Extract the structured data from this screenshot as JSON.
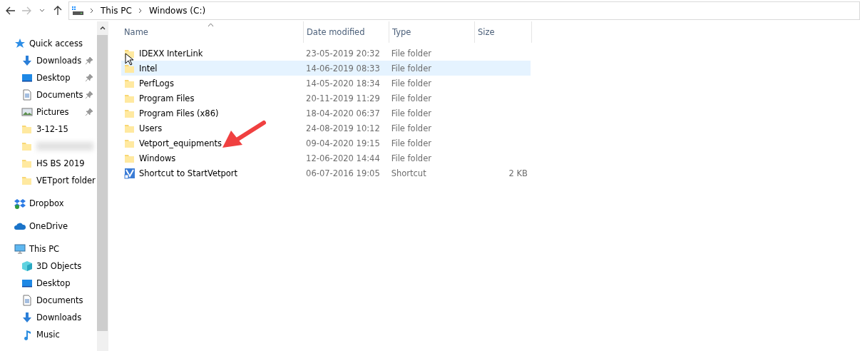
{
  "address_bar": {
    "crumbs": [
      "This PC",
      "Windows (C:)"
    ]
  },
  "nav": [
    {
      "label": "Quick access",
      "kind": "star",
      "children": [
        {
          "label": "Downloads",
          "kind": "download",
          "pinned": true
        },
        {
          "label": "Desktop",
          "kind": "desktop",
          "pinned": true
        },
        {
          "label": "Documents",
          "kind": "document",
          "pinned": true
        },
        {
          "label": "Pictures",
          "kind": "pictures",
          "pinned": true
        },
        {
          "label": "3-12-15",
          "kind": "folder",
          "pinned": false
        },
        {
          "kind": "blurred",
          "pinned": false
        },
        {
          "label": "HS BS 2019",
          "kind": "folder",
          "pinned": false
        },
        {
          "label": "VETport folder",
          "kind": "folder",
          "pinned": false
        }
      ]
    },
    {
      "label": "Dropbox",
      "kind": "dropbox"
    },
    {
      "label": "OneDrive",
      "kind": "cloud"
    },
    {
      "label": "This PC",
      "kind": "pc",
      "children": [
        {
          "label": "3D Objects",
          "kind": "cube",
          "pinned": false
        },
        {
          "label": "Desktop",
          "kind": "desktop",
          "pinned": false
        },
        {
          "label": "Documents",
          "kind": "document",
          "pinned": false
        },
        {
          "label": "Downloads",
          "kind": "download",
          "pinned": false
        },
        {
          "label": "Music",
          "kind": "music",
          "pinned": false
        }
      ]
    }
  ],
  "table": {
    "columns": [
      "Name",
      "Date modified",
      "Type",
      "Size"
    ],
    "rows": [
      {
        "name": "IDEXX InterLink",
        "date": "23-05-2019 20:32",
        "type": "File folder",
        "kind": "folder",
        "hovered": false
      },
      {
        "name": "Intel",
        "date": "14-06-2019 08:33",
        "type": "File folder",
        "kind": "folder",
        "hovered": true
      },
      {
        "name": "PerfLogs",
        "date": "14-05-2020 18:34",
        "type": "File folder",
        "kind": "folder",
        "hovered": false
      },
      {
        "name": "Program Files",
        "date": "20-11-2019 11:29",
        "type": "File folder",
        "kind": "folder",
        "hovered": false
      },
      {
        "name": "Program Files (x86)",
        "date": "18-04-2020 06:37",
        "type": "File folder",
        "kind": "folder",
        "hovered": false
      },
      {
        "name": "Users",
        "date": "24-08-2019 10:12",
        "type": "File folder",
        "kind": "folder",
        "hovered": false
      },
      {
        "name": "Vetport_equipments",
        "date": "09-04-2020 19:15",
        "type": "File folder",
        "kind": "folder",
        "hovered": false
      },
      {
        "name": "Windows",
        "date": "12-06-2020 14:44",
        "type": "File folder",
        "kind": "folder",
        "hovered": false
      },
      {
        "name": "Shortcut to StartVetport",
        "date": "06-07-2016 19:05",
        "type": "Shortcut",
        "size": "2 KB",
        "kind": "shortcut",
        "hovered": false
      }
    ]
  }
}
